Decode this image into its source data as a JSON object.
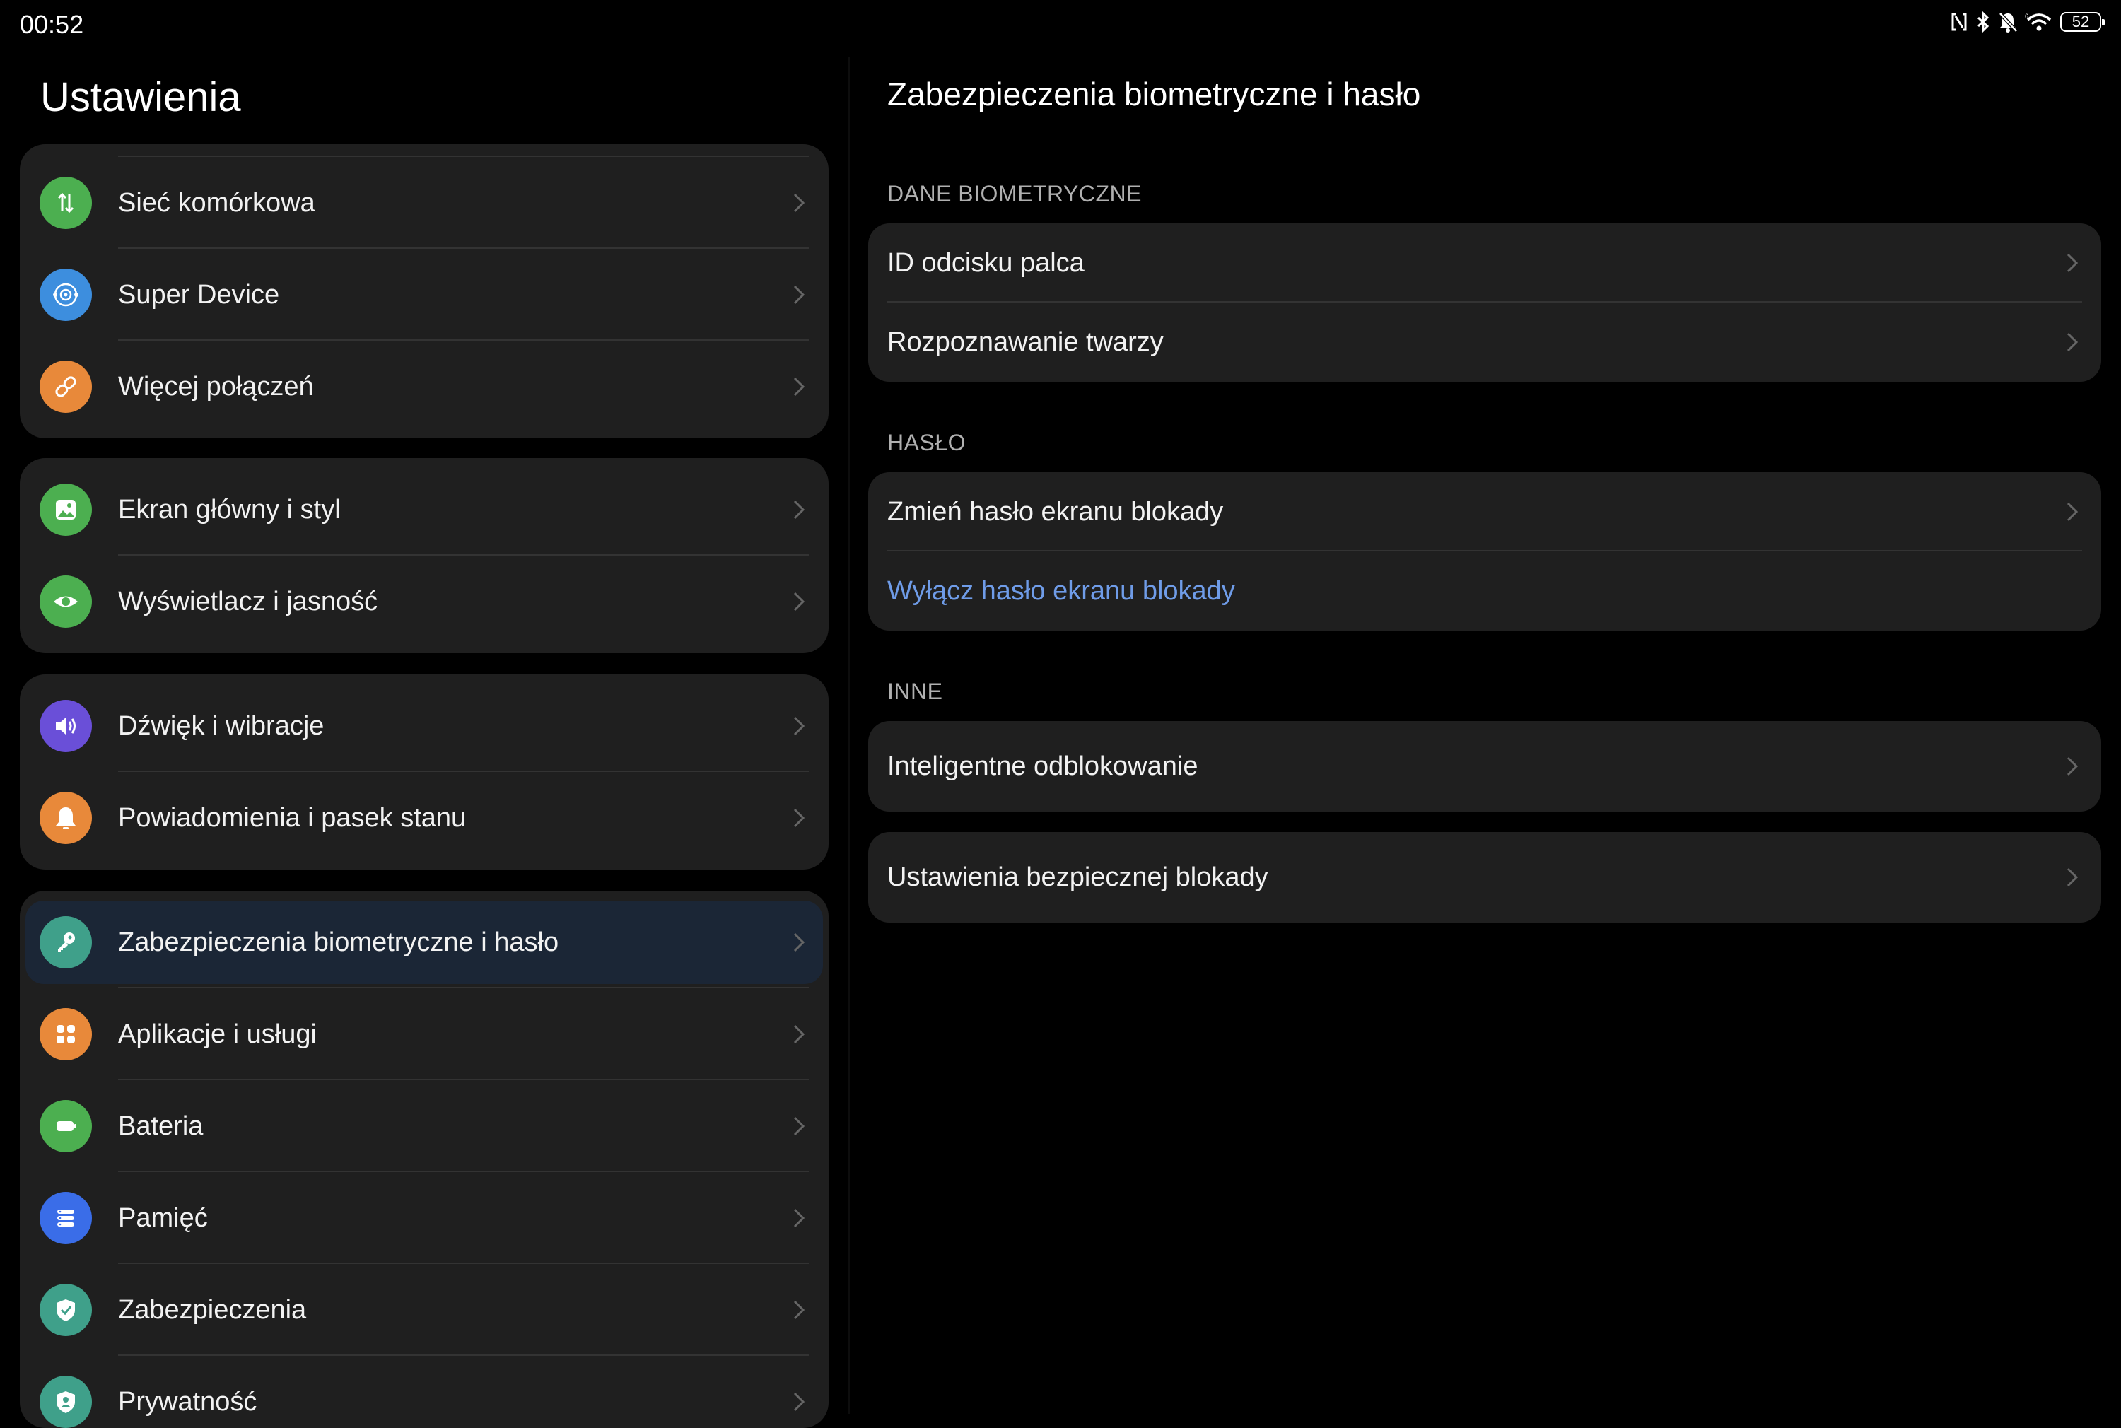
{
  "status_bar": {
    "time": "00:52",
    "battery": "52",
    "icons": [
      "nfc-icon",
      "bluetooth-icon",
      "mute-icon",
      "wifi-icon",
      "battery-icon"
    ]
  },
  "left": {
    "title": "Ustawienia",
    "groups": [
      {
        "items": [
          {
            "label": "Sieć komórkowa",
            "icon": "mobile-data-icon",
            "color": "#4caf50"
          },
          {
            "label": "Super Device",
            "icon": "super-device-icon",
            "color": "#3d8ede"
          },
          {
            "label": "Więcej połączeń",
            "icon": "link-icon",
            "color": "#e8893a"
          }
        ]
      },
      {
        "items": [
          {
            "label": "Ekran główny i styl",
            "icon": "image-icon",
            "color": "#4caf50"
          },
          {
            "label": "Wyświetlacz i jasność",
            "icon": "eye-icon",
            "color": "#4caf50"
          }
        ]
      },
      {
        "items": [
          {
            "label": "Dźwięk i wibracje",
            "icon": "speaker-icon",
            "color": "#6a4fd8"
          },
          {
            "label": "Powiadomienia i pasek stanu",
            "icon": "bell-icon",
            "color": "#e8893a"
          }
        ]
      },
      {
        "items": [
          {
            "label": "Zabezpieczenia biometryczne i hasło",
            "icon": "key-icon",
            "color": "#3fa08a",
            "selected": true
          },
          {
            "label": "Aplikacje i usługi",
            "icon": "apps-grid-icon",
            "color": "#e8893a"
          },
          {
            "label": "Bateria",
            "icon": "battery-setting-icon",
            "color": "#4caf50"
          },
          {
            "label": "Pamięć",
            "icon": "storage-icon",
            "color": "#3a6de8"
          },
          {
            "label": "Zabezpieczenia",
            "icon": "shield-check-icon",
            "color": "#3fa08a"
          },
          {
            "label": "Prywatność",
            "icon": "privacy-icon",
            "color": "#3fa08a"
          }
        ]
      }
    ]
  },
  "right": {
    "title": "Zabezpieczenia biometryczne i hasło",
    "sections": [
      {
        "header": "DANE BIOMETRYCZNE",
        "items": [
          {
            "label": "ID odcisku palca"
          },
          {
            "label": "Rozpoznawanie twarzy"
          }
        ]
      },
      {
        "header": "HASŁO",
        "items": [
          {
            "label": "Zmień hasło ekranu blokady"
          },
          {
            "label": "Wyłącz hasło ekranu blokady",
            "link": true
          }
        ]
      },
      {
        "header": "INNE",
        "items": [
          {
            "label": "Inteligentne odblokowanie"
          }
        ]
      },
      {
        "header": "",
        "items": [
          {
            "label": "Ustawienia bezpiecznej blokady"
          }
        ]
      }
    ],
    "link_color": "#6f9ce8"
  }
}
